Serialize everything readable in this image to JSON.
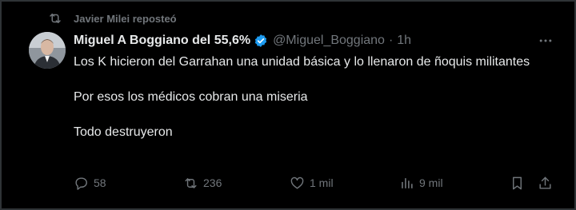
{
  "social_context": {
    "text": "Javier Milei reposteó",
    "icon": "repost-icon"
  },
  "author": {
    "display_name": "Miguel A Boggiano del 55,6%",
    "verified_icon": "verified-badge-icon",
    "handle": "@Miguel_Boggiano",
    "separator": "·",
    "time": "1h"
  },
  "tweet": {
    "lines": [
      "Los K hicieron del Garrahan una unidad básica y lo llenaron de ñoquis militantes",
      "Por esos los médicos cobran una miseria",
      "Todo destruyeron"
    ]
  },
  "actions": {
    "reply_count": "58",
    "repost_count": "236",
    "like_count": "1 mil",
    "view_count": "9 mil"
  },
  "colors": {
    "background": "#000000",
    "text_primary": "#e7e9ea",
    "text_secondary": "#71767b",
    "verified": "#1d9bf0"
  }
}
